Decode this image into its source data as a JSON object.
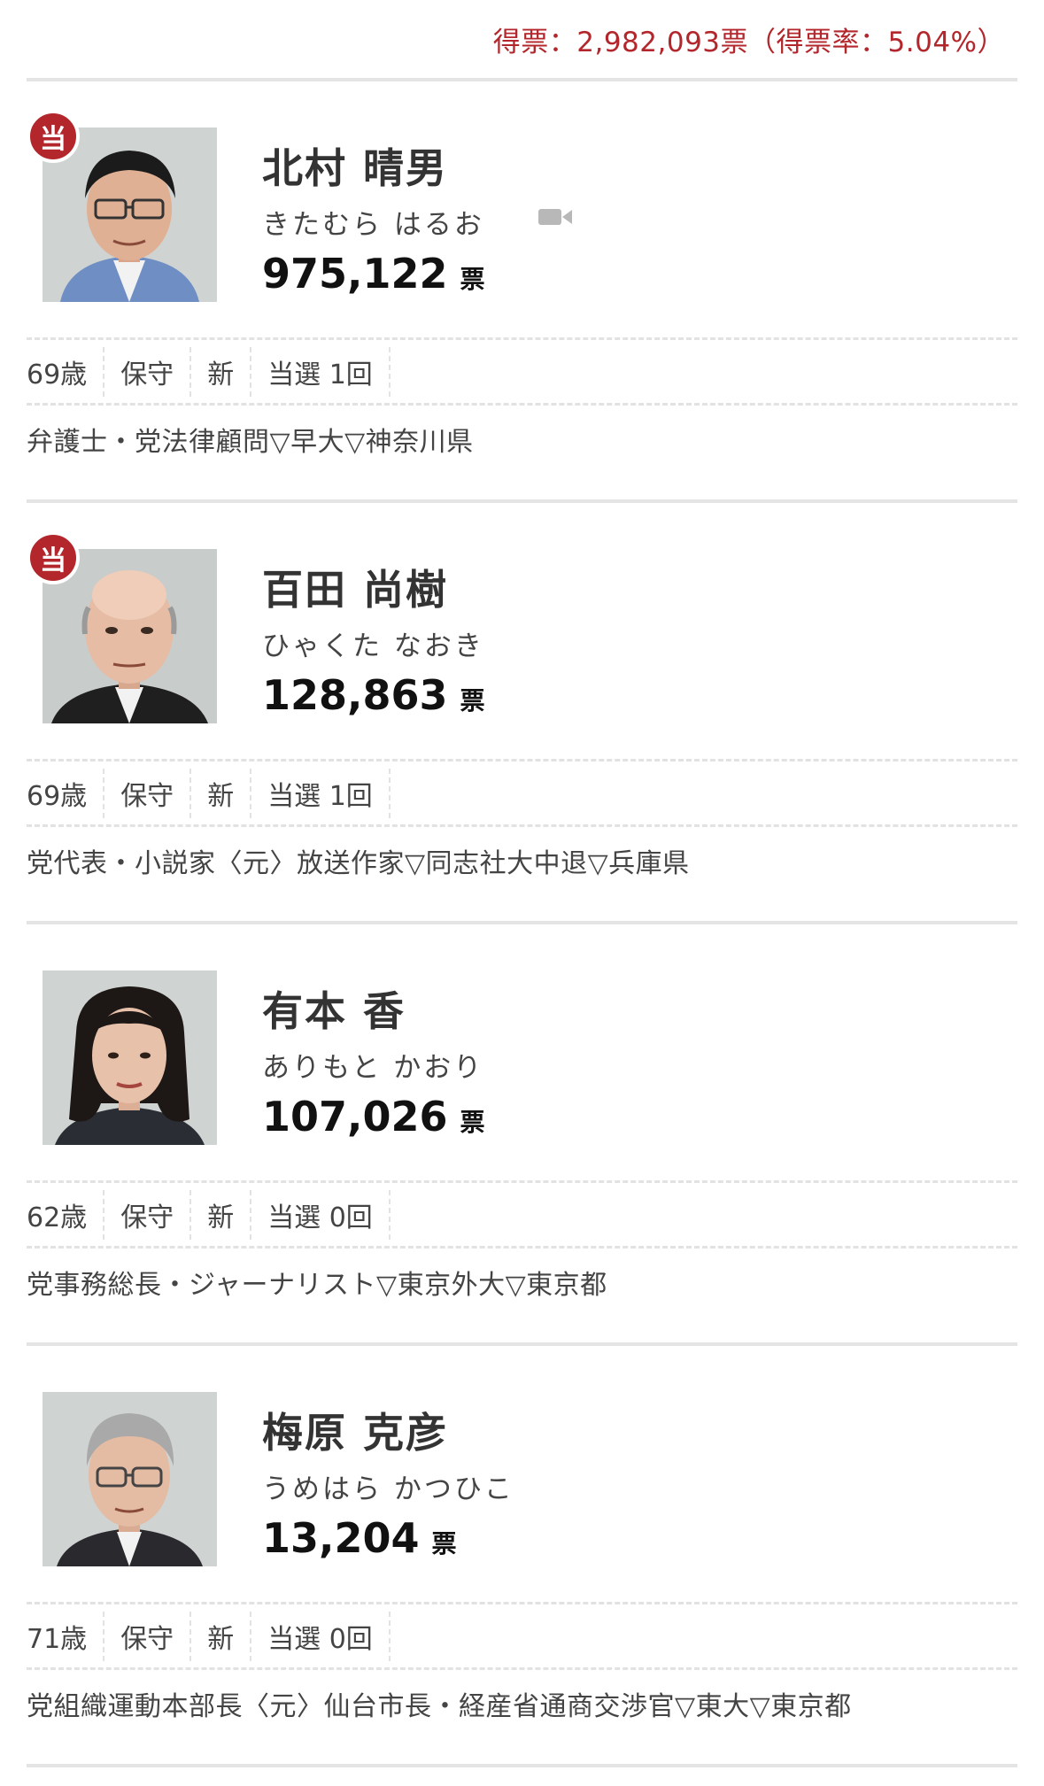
{
  "summary": {
    "total_votes_text": "得票：2,982,093票（得票率：5.04%）"
  },
  "colors": {
    "accent_red": "#b3262b",
    "divider": "#e4e4e4"
  },
  "vote_unit": "票",
  "win_badge_label": "当",
  "candidates": [
    {
      "name": "北村 晴男",
      "kana": "きたむら はるお",
      "votes": "975,122",
      "elected": true,
      "has_video": true,
      "age": "69歳",
      "ideology": "保守",
      "status": "新",
      "times_elected": "当選 1回",
      "career": "弁護士・党法律顧問▽早大▽神奈川県"
    },
    {
      "name": "百田 尚樹",
      "kana": "ひゃくた なおき",
      "votes": "128,863",
      "elected": true,
      "has_video": false,
      "age": "69歳",
      "ideology": "保守",
      "status": "新",
      "times_elected": "当選 1回",
      "career": "党代表・小説家〈元〉放送作家▽同志社大中退▽兵庫県"
    },
    {
      "name": "有本 香",
      "kana": "ありもと かおり",
      "votes": "107,026",
      "elected": false,
      "has_video": false,
      "age": "62歳",
      "ideology": "保守",
      "status": "新",
      "times_elected": "当選 0回",
      "career": "党事務総長・ジャーナリスト▽東京外大▽東京都"
    },
    {
      "name": "梅原 克彦",
      "kana": "うめはら かつひこ",
      "votes": "13,204",
      "elected": false,
      "has_video": false,
      "age": "71歳",
      "ideology": "保守",
      "status": "新",
      "times_elected": "当選 0回",
      "career": "党組織運動本部長〈元〉仙台市長・経産省通商交渉官▽東大▽東京都"
    }
  ]
}
